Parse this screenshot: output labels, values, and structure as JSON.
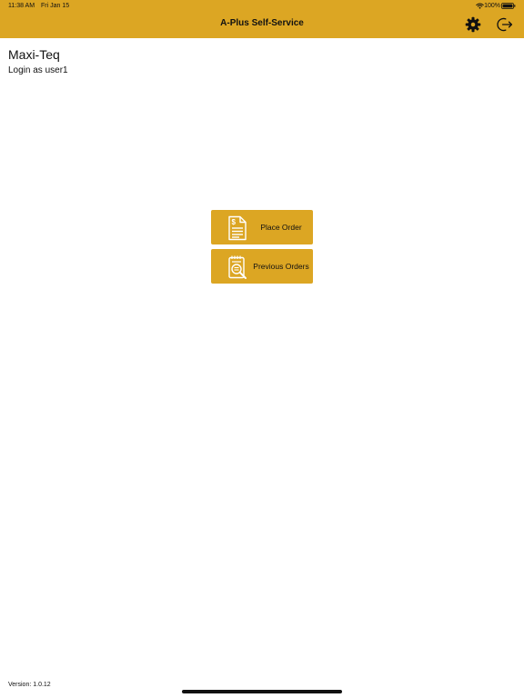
{
  "status_bar": {
    "time": "11:38 AM",
    "date": "Fri Jan 15",
    "battery_percent": "100%"
  },
  "header": {
    "title": "A-Plus Self-Service",
    "settings_icon": "gear-icon",
    "logout_icon": "logout-icon"
  },
  "account": {
    "company": "Maxi-Teq",
    "login_text": "Login as user1"
  },
  "menu": {
    "place_order": {
      "label": "Place Order",
      "icon": "invoice-dollar-icon"
    },
    "previous_orders": {
      "label": "Previous Orders",
      "icon": "order-history-icon"
    }
  },
  "footer": {
    "version": "Version: 1.0.12"
  },
  "colors": {
    "accent": "#dca623",
    "text": "#111111",
    "background": "#ffffff"
  }
}
